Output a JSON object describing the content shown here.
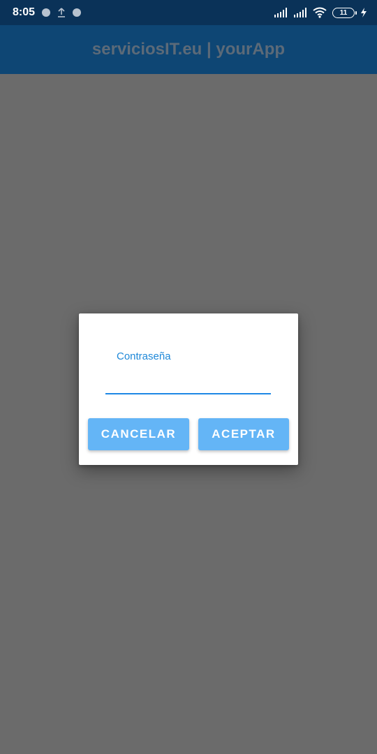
{
  "status_bar": {
    "time": "8:05",
    "icons": [
      "notification-dot-icon",
      "upload-icon",
      "notification-dot-icon",
      "signal-icon",
      "signal-icon",
      "wifi-icon",
      "battery-icon",
      "charging-bolt-icon"
    ],
    "battery_level": "11"
  },
  "app_bar": {
    "title": "serviciosIT.eu | yourApp"
  },
  "dialog": {
    "field_label": "Contraseña",
    "field_value": "",
    "cancel_label": "CANCELAR",
    "accept_label": "ACEPTAR"
  },
  "colors": {
    "status_bar_bg": "#0a3258",
    "app_bar_bg": "#0e4674",
    "scrim": "#6b6b6b",
    "accent": "#1e88e5",
    "button_bg": "#64b5f6"
  }
}
